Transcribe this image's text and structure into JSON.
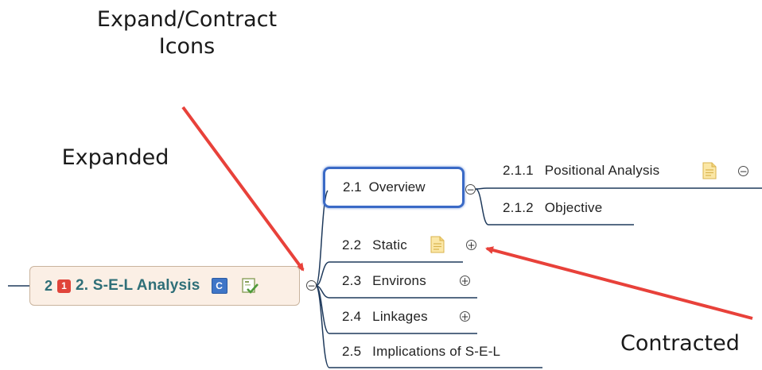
{
  "callouts": {
    "title": "Expand/Contract\nIcons",
    "expanded": "Expanded",
    "contracted": "Contracted"
  },
  "root": {
    "number": "2",
    "priority": "1",
    "title": "2. S-E-L Analysis",
    "category_badge": "C",
    "icons": [
      "priority-1-icon",
      "category-c-icon",
      "task-checklist-icon"
    ],
    "toggle_state": "expanded"
  },
  "subtopics": [
    {
      "num": "2.1",
      "label": "Overview",
      "toggle_state": "expanded",
      "selected": true
    },
    {
      "num": "2.2",
      "label": "Static",
      "toggle_state": "contracted",
      "has_note": true
    },
    {
      "num": "2.3",
      "label": "Environs",
      "toggle_state": "contracted"
    },
    {
      "num": "2.4",
      "label": "Linkages",
      "toggle_state": "contracted"
    },
    {
      "num": "2.5",
      "label": "Implications of S-E-L"
    }
  ],
  "overview_children": [
    {
      "num": "2.1.1",
      "label": "Positional Analysis",
      "has_note": true,
      "toggle_state": "expanded"
    },
    {
      "num": "2.1.2",
      "label": "Objective"
    }
  ],
  "toggle_symbols": {
    "expanded": "−",
    "contracted": "+"
  },
  "colors": {
    "arrow": "#e8413a",
    "selection_border": "#3a6ac6",
    "root_fill": "#fbefe5",
    "root_text": "#2f6f78",
    "line": "#1f3a5c"
  }
}
